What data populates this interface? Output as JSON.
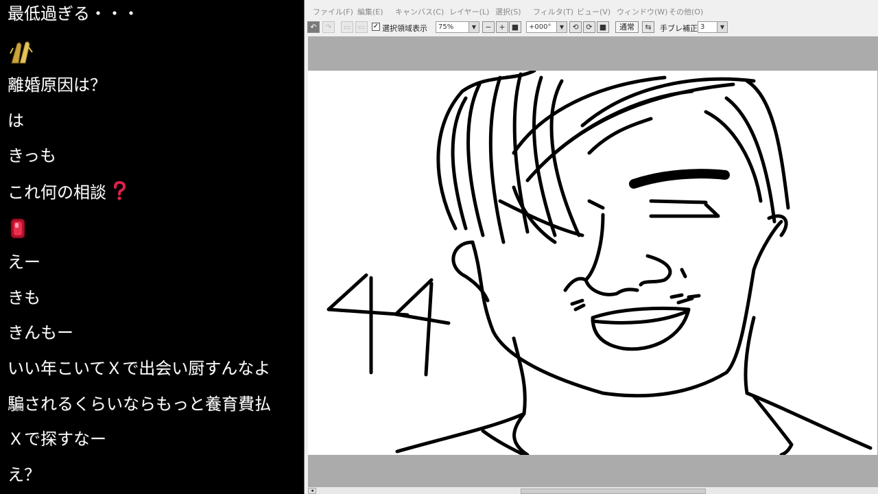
{
  "chat": {
    "comments": [
      {
        "text": "最低過ぎる・・・",
        "emoji": null
      },
      {
        "text": "",
        "emoji": "praying-hands-gold"
      },
      {
        "text": "離婚原因は？",
        "emoji": null
      },
      {
        "text": "は",
        "emoji": null
      },
      {
        "text": "きっも",
        "emoji": null
      },
      {
        "text": "これ何の相談",
        "emoji": "question-mark-red"
      },
      {
        "text": "",
        "emoji": "red-gem"
      },
      {
        "text": "えー",
        "emoji": null
      },
      {
        "text": "きも",
        "emoji": null
      },
      {
        "text": "きんもー",
        "emoji": null
      },
      {
        "text": "いい年こいてＸで出会い厨すんなよ",
        "emoji": null
      },
      {
        "text": "騙されるくらいならもっと養育費払",
        "emoji": null
      },
      {
        "text": "Ｘで探すなー",
        "emoji": null
      },
      {
        "text": "え？",
        "emoji": null
      }
    ]
  },
  "app": {
    "menu": [
      "ファイル(F)",
      "編集(E)",
      "キャンバス(C)",
      "レイヤー(L)",
      "選択(S)",
      "フィルタ(T)",
      "ビュー(V)",
      "ウィンドウ(W)",
      "その他(O)"
    ],
    "toolbar": {
      "selection_display_label": "選択領域表示",
      "selection_display_checked": true,
      "zoom_value": "75%",
      "rotation_value": "+000°",
      "blend_mode_label": "通常",
      "stabilizer_label": "手ブレ補正",
      "stabilizer_value": "3"
    },
    "canvas": {
      "drawn_text": "44"
    }
  }
}
